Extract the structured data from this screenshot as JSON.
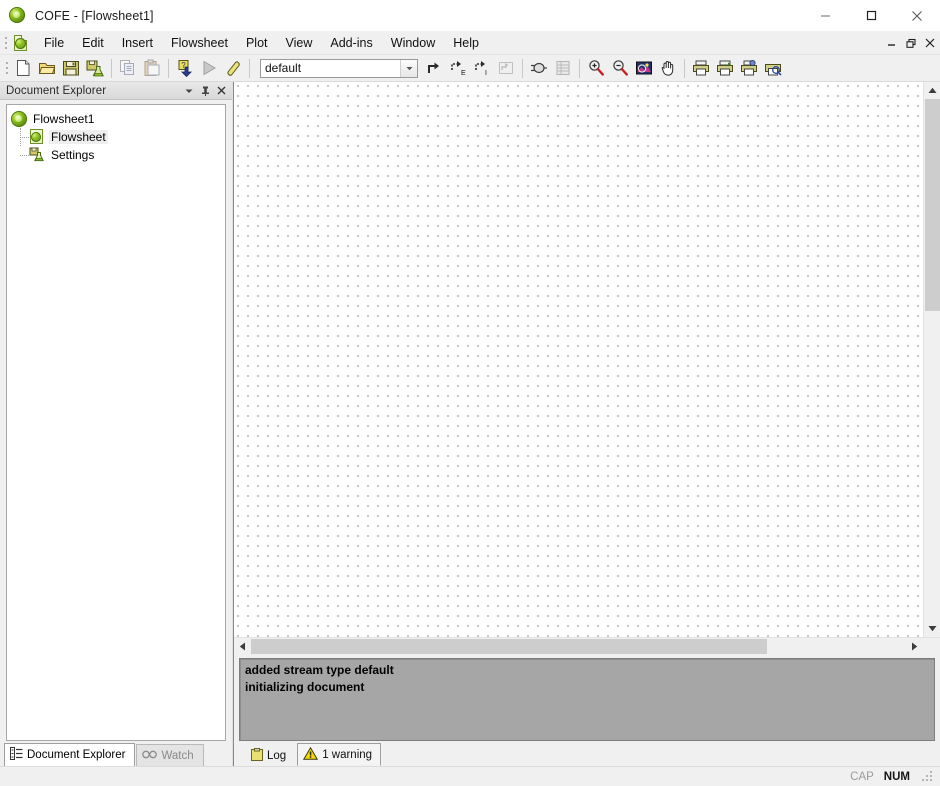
{
  "window": {
    "title": "COFE - [Flowsheet1]",
    "app_icon": "cofe-orb-icon",
    "controls": {
      "minimize": "minimize-icon",
      "maximize": "maximize-icon",
      "close": "close-icon"
    }
  },
  "menubar": {
    "document_icon": "document-orb-icon",
    "items": [
      {
        "label": "File"
      },
      {
        "label": "Edit"
      },
      {
        "label": "Insert"
      },
      {
        "label": "Flowsheet"
      },
      {
        "label": "Plot"
      },
      {
        "label": "View"
      },
      {
        "label": "Add-ins"
      },
      {
        "label": "Window"
      },
      {
        "label": "Help"
      }
    ],
    "mdi_controls": {
      "minimize": "mdi-minimize-icon",
      "restore": "mdi-restore-icon",
      "close": "mdi-close-icon"
    }
  },
  "toolbar": {
    "groups": [
      [
        "new-document-icon",
        "open-document-icon",
        "save-document-icon",
        "save-as-flask-icon"
      ],
      [
        "copy-icon",
        "paste-icon"
      ],
      [
        "import-icon",
        "run-icon",
        "eraser-icon"
      ]
    ],
    "stream_type_combo": {
      "value": "default",
      "placeholder": "default",
      "arrow": "chevron-down-icon"
    },
    "after_combo": [
      "stream-icon",
      "energy-stream-icon",
      "information-stream-icon",
      "unit-operation-icon"
    ],
    "group_objects": [
      "unit-op-oval-icon",
      "table-icon"
    ],
    "group_zoom": [
      "zoom-in-icon",
      "zoom-out-icon",
      "zoom-fit-icon",
      "pan-hand-icon"
    ],
    "group_print": [
      "print-icon",
      "print-preview-icon",
      "print-setup-icon",
      "print-area-icon"
    ]
  },
  "dock": {
    "caption": "Document Explorer",
    "caption_buttons": {
      "menu": "chevron-down-icon",
      "pin": "pin-icon",
      "close": "close-icon"
    },
    "tree": [
      {
        "label": "Flowsheet1",
        "icon": "cofe-orb-icon",
        "level": 0,
        "selected": false
      },
      {
        "label": "Flowsheet",
        "icon": "flowsheet-document-icon",
        "level": 1,
        "selected": true
      },
      {
        "label": "Settings",
        "icon": "settings-flask-icon",
        "level": 1,
        "selected": false
      }
    ],
    "tabs": [
      {
        "label": "Document Explorer",
        "icon": "document-explorer-icon",
        "active": true
      },
      {
        "label": "Watch",
        "icon": "watch-glasses-icon",
        "active": false
      }
    ]
  },
  "canvas": {
    "grid": "dot-grid",
    "vertical_scrollbar": {
      "up_arrow": "scroll-up-icon",
      "down_arrow": "scroll-down-icon"
    },
    "horizontal_scrollbar": {
      "left_arrow": "scroll-left-icon",
      "right_arrow": "scroll-right-icon"
    }
  },
  "log": {
    "lines": [
      "added stream type default",
      "initializing document"
    ],
    "tabs": [
      {
        "label": "Log",
        "icon": "log-clipboard-icon",
        "active": false
      },
      {
        "label": "1 warning",
        "icon": "warning-triangle-icon",
        "active": true
      }
    ]
  },
  "statusbar": {
    "caps": "CAP",
    "num": "NUM",
    "resize_grip": "resize-grip-icon"
  },
  "colors": {
    "accent_green": "#8cc020",
    "warning_yellow": "#f5d800",
    "log_background": "#a6a6a6",
    "window_background": "#f0f0f0"
  }
}
